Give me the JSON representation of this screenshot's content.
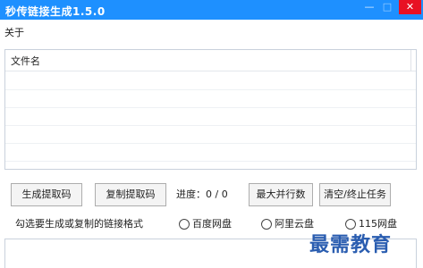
{
  "window": {
    "title": "秒传链接生成1.5.0",
    "min_glyph": "—",
    "max_glyph": "□",
    "close_glyph": "✕"
  },
  "menu": {
    "about": "关于"
  },
  "list": {
    "columns": [
      "文件名"
    ],
    "rows": []
  },
  "actions": {
    "generate": "生成提取码",
    "copy": "复制提取码",
    "progress": "进度：0 / 0",
    "max_parallel": "最大并行数",
    "clear_stop": "清空/终止任务"
  },
  "format": {
    "label": "勾选要生成或复制的链接格式",
    "options": [
      {
        "label": "百度网盘",
        "checked": false
      },
      {
        "label": "阿里云盘",
        "checked": false
      },
      {
        "label": "115网盘",
        "checked": false
      }
    ]
  },
  "watermark": "最需教育",
  "colors": {
    "titlebar": "#1e90ff",
    "close": "#e81123",
    "watermark": "#2a5db0"
  }
}
